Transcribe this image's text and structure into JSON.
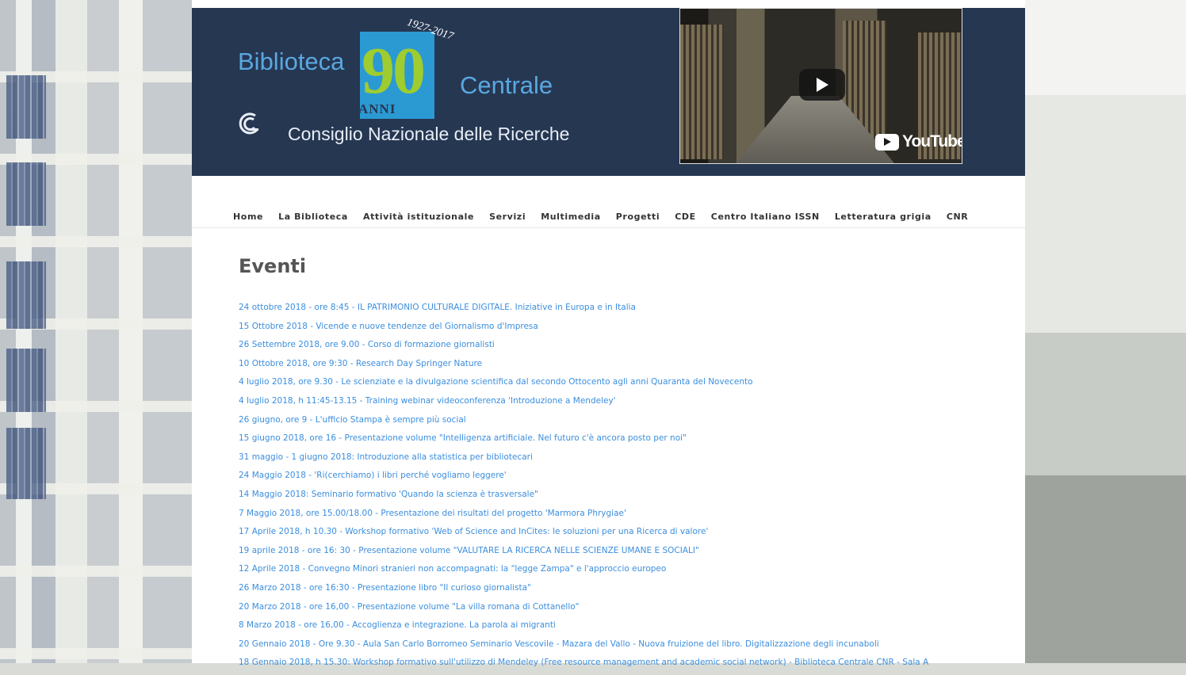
{
  "header": {
    "logo": {
      "biblioteca": "Biblioteca",
      "centrale": "Centrale",
      "anniversary_number": "90",
      "years": "1927-2017",
      "anni": "ANNI",
      "organization": "Consiglio Nazionale delle Ricerche"
    },
    "video": {
      "brand": "YouTube"
    }
  },
  "nav": {
    "items": [
      "Home",
      "La Biblioteca",
      "Attività istituzionale",
      "Servizi",
      "Multimedia",
      "Progetti",
      "CDE",
      "Centro Italiano ISSN",
      "Letteratura grigia",
      "CNR"
    ]
  },
  "page": {
    "title": "Eventi"
  },
  "events": [
    "24 ottobre 2018 - ore 8:45 - IL PATRIMONIO CULTURALE DIGITALE. Iniziative in Europa e in Italia",
    "15 Ottobre 2018 - Vicende e nuove tendenze del Giornalismo d'Impresa",
    "26 Settembre 2018, ore 9.00 - Corso di formazione giornalisti",
    "10 Ottobre 2018, ore 9:30 - Research Day Springer Nature",
    "4 luglio 2018, ore 9.30 - Le scienziate e la divulgazione scientifica dal secondo Ottocento agli anni Quaranta del Novecento",
    "4 luglio 2018, h 11:45-13.15 - Training webinar videoconferenza 'Introduzione a Mendeley'",
    "26 giugno, ore 9 - L'ufficio Stampa è sempre più social",
    "15 giugno 2018, ore 16 - Presentazione volume \"Intelligenza artificiale. Nel futuro c'è ancora posto per noi\"",
    "31 maggio - 1 giugno 2018: Introduzione alla statistica per bibliotecari",
    "24 Maggio 2018 - 'Ri(cerchiamo) i libri perché vogliamo leggere'",
    "14 Maggio 2018: Seminario formativo 'Quando la scienza è trasversale\"",
    "7 Maggio 2018, ore 15.00/18.00 - Presentazione dei risultati del progetto 'Marmora Phrygiae'",
    "17 Aprile 2018, h 10.30 - Workshop formativo 'Web of Science and InCites: le soluzioni per una Ricerca di valore'",
    "19 aprile 2018 - ore 16: 30 - Presentazione volume \"VALUTARE LA RICERCA NELLE SCIENZE UMANE E SOCIALI\"",
    "12 Aprile 2018 - Convegno Minori stranieri non accompagnati: la \"legge Zampa\" e l'approccio europeo",
    "26 Marzo 2018 - ore 16:30 - Presentazione libro \"Il curioso giornalista\"",
    "20 Marzo 2018 - ore 16,00 - Presentazione volume \"La villa romana di Cottanello\"",
    "8 Marzo 2018 - ore 16,00 - Accoglienza e integrazione. La parola ai migranti",
    "20 Gennaio 2018 - Ore 9.30 - Aula San Carlo Borromeo Seminario Vescovile - Mazara del Vallo - Nuova fruizione del libro. Digitalizzazione degli incunaboli",
    "18 Gennaio 2018, h 15.30: Workshop formativo sull'utilizzo di Mendeley (Free resource management and academic social network) - Biblioteca Centrale CNR - Sala A"
  ]
}
